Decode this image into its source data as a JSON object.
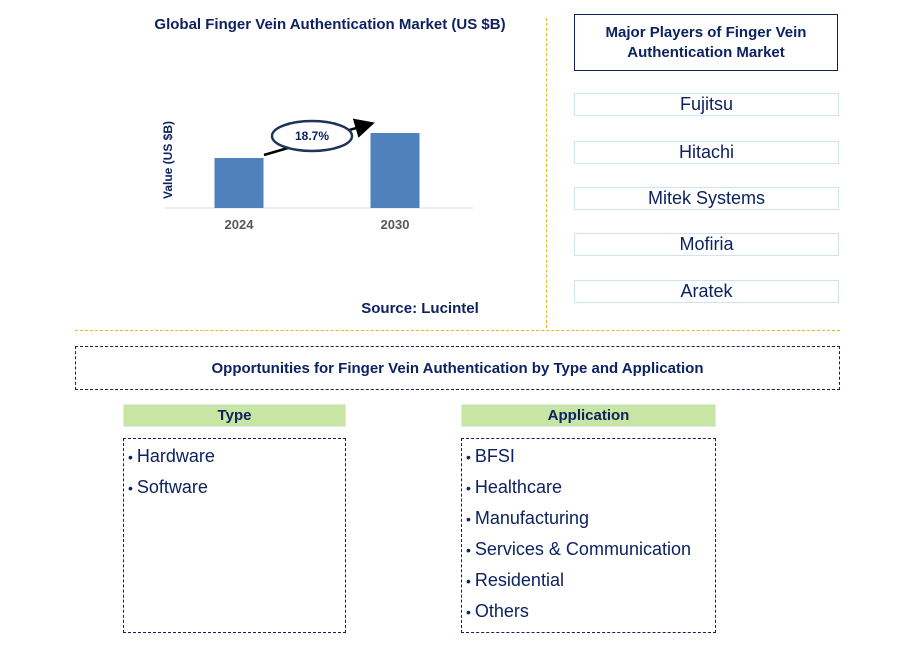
{
  "chart_data": {
    "type": "bar",
    "title": "Global Finger Vein Authentication Market (US $B)",
    "xlabel": "",
    "ylabel": "Value (US $B)",
    "categories": [
      "2024",
      "2030"
    ],
    "values": [
      1.0,
      1.5
    ],
    "value_note": "relative bar heights only; no axis values shown",
    "annotation": {
      "text": "18.7%",
      "meaning": "CAGR 2024-2030"
    },
    "source": "Source: Lucintel",
    "bar_color": "#4f81bd",
    "grid": false,
    "legend": "none"
  },
  "players": {
    "title": "Major Players of Finger Vein Authentication Market",
    "items": [
      "Fujitsu",
      "Hitachi",
      "Mitek Systems",
      "Mofiria",
      "Aratek"
    ]
  },
  "opportunities": {
    "title": "Opportunities for Finger Vein Authentication by Type and Application",
    "type": {
      "header": "Type",
      "items": [
        "Hardware",
        "Software"
      ]
    },
    "application": {
      "header": "Application",
      "items": [
        "BFSI",
        "Healthcare",
        "Manufacturing",
        "Services & Communication",
        "Residential",
        "Others"
      ]
    }
  },
  "colors": {
    "text": "#0d2260",
    "bar": "#4f81bd",
    "divider": "#f2b51c",
    "segment_header": "#c9e5a3"
  }
}
